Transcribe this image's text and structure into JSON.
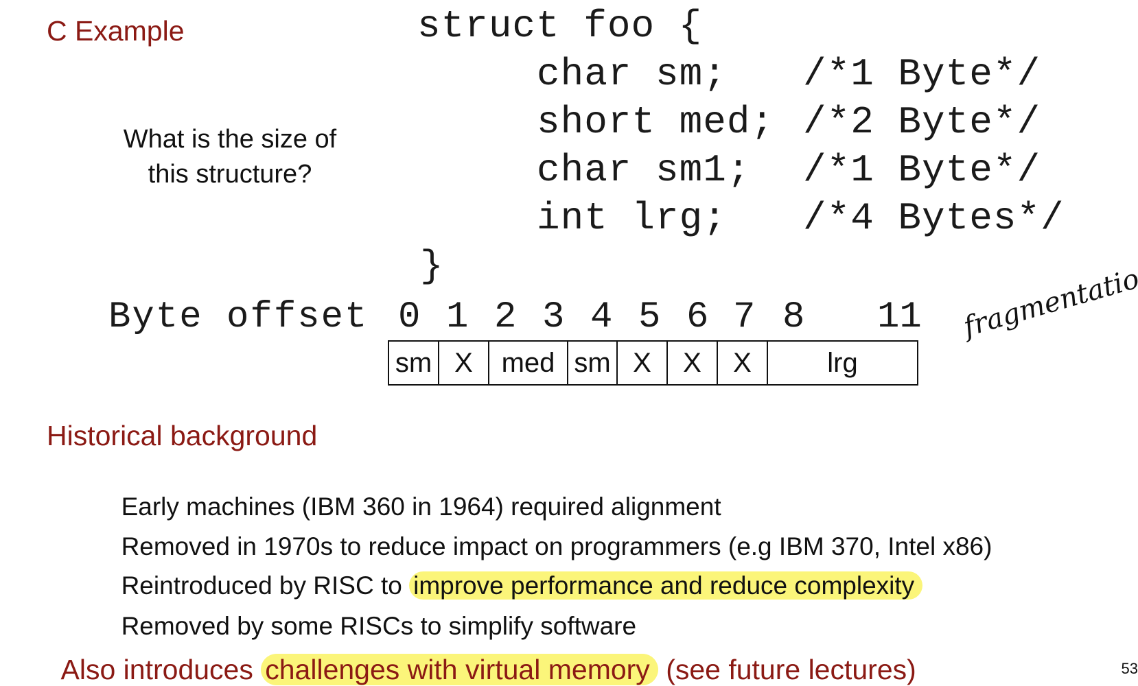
{
  "title": "C Example",
  "question": "What is the size of this structure?",
  "code": {
    "open": "struct foo {",
    "fields": [
      {
        "decl": "char sm;",
        "comment": "/*1 Byte*/"
      },
      {
        "decl": "short med;",
        "comment": "/*2 Byte*/"
      },
      {
        "decl": "char sm1;",
        "comment": "/*1 Byte*/"
      },
      {
        "decl": "int lrg;",
        "comment": "/*4 Bytes*/"
      }
    ],
    "close": "}"
  },
  "layout": {
    "offset_label": "Byte offset",
    "ticks": [
      "0",
      "1",
      "2",
      "3",
      "4",
      "5",
      "6",
      "7",
      "8",
      "11"
    ],
    "cells": [
      "sm",
      "X",
      "med",
      "sm",
      "X",
      "X",
      "X",
      "lrg"
    ]
  },
  "annotation": "fragmentation!!",
  "history": {
    "heading": "Historical background",
    "bullets": [
      {
        "text": "Early machines (IBM 360 in 1964) required alignment",
        "highlight": ""
      },
      {
        "text": "Removed in 1970s to reduce impact on programmers (e.g IBM 370, Intel x86)",
        "highlight": ""
      },
      {
        "text": "Reintroduced by RISC to ",
        "highlight": "improve performance and reduce complexity"
      },
      {
        "text": "Removed by some RISCs to simplify software",
        "highlight": ""
      }
    ]
  },
  "closing": {
    "before": "Also introduces ",
    "highlight": "challenges with virtual memory",
    "after": " (see future lectures)"
  },
  "page_number": "53",
  "colors": {
    "accent": "#8b1a14",
    "highlight": "#fbf57a"
  }
}
